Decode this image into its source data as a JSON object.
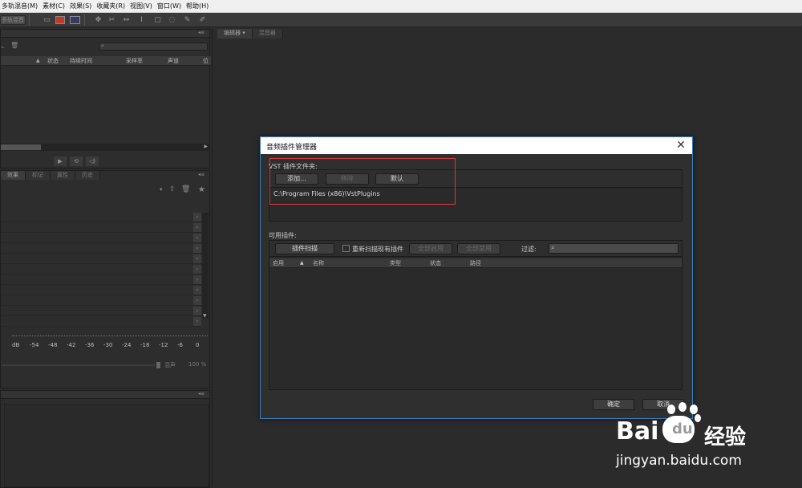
{
  "menu": [
    "多轨混音(M)",
    "素材(C)",
    "效果(S)",
    "收藏夹(R)",
    "视图(V)",
    "窗口(W)",
    "帮助(H)"
  ],
  "toolbar": {
    "mode_label": "多轨混音"
  },
  "files_panel": {
    "columns": [
      "状态",
      "持续时间",
      "采样率",
      "声道",
      "位"
    ]
  },
  "effects_panel": {
    "tabs": [
      "效果",
      "标记",
      "属性",
      "历史"
    ]
  },
  "meter": {
    "scale": [
      "dB",
      "-54",
      "-48",
      "-42",
      "-36",
      "-30",
      "-24",
      "-18",
      "-12",
      "-6",
      "0"
    ],
    "mute_label": "混声",
    "percent": "100 %"
  },
  "editor_tabs": [
    "编辑器",
    "混音器"
  ],
  "dialog": {
    "title": "音频插件管理器",
    "vst_group_label": "VST 插件文件夹:",
    "add_button": "添加...",
    "remove_button": "移除",
    "default_button": "默认",
    "folder_path": "C:\\Program Files (x86)\\VstPlugins",
    "available_label": "可用插件:",
    "scan_button": "插件扫描",
    "rescan_checkbox_label": "重新扫描现有插件",
    "enable_all_button": "全部启用",
    "disable_all_button": "全部禁用",
    "filter_label": "过滤:",
    "columns": [
      "启用",
      "名称",
      "类型",
      "状态",
      "路径"
    ],
    "ok_button": "确定",
    "cancel_button": "取消"
  },
  "watermark": {
    "brand": "Bai",
    "brand2": "经验",
    "url": "jingyan.baidu.com"
  }
}
